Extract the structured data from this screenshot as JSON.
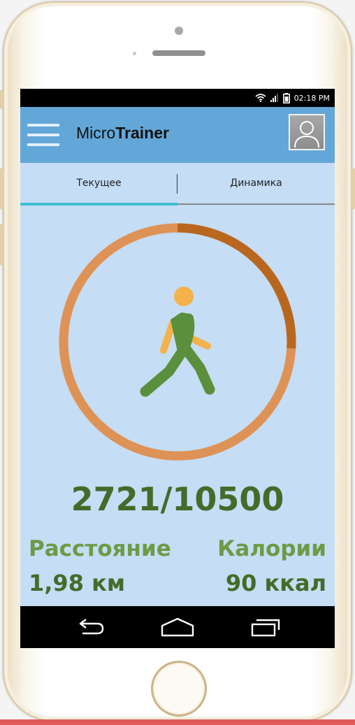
{
  "status_bar": {
    "time": "02:18 PM"
  },
  "app": {
    "title_light": "Micro",
    "title_bold": "Trainer"
  },
  "tabs": [
    {
      "label": "Текущее",
      "active": true
    },
    {
      "label": "Динамика",
      "active": false
    }
  ],
  "progress": {
    "current": 2721,
    "goal": 10500,
    "text": "2721/10500"
  },
  "stats": {
    "distance": {
      "label": "Расстояние",
      "value": "1,98 км"
    },
    "calories": {
      "label": "Калории",
      "value": "90 ккал"
    }
  },
  "colors": {
    "screen_bg": "#c5ddf5",
    "app_bar": "#63a7d8",
    "ring_done": "#b9671f",
    "ring_remaining": "#df9255",
    "tab_indicator": "#3fc0d3",
    "figure_body": "#5a8f3c",
    "figure_head": "#f5b14a",
    "text_dark_green": "#456b2a",
    "text_light_green": "#6d9a46"
  },
  "icons": {
    "menu": "hamburger-icon",
    "avatar": "user-avatar-icon",
    "walker": "walking-person-icon",
    "back": "back-arrow-icon",
    "home": "home-icon",
    "recents": "recent-apps-icon"
  }
}
